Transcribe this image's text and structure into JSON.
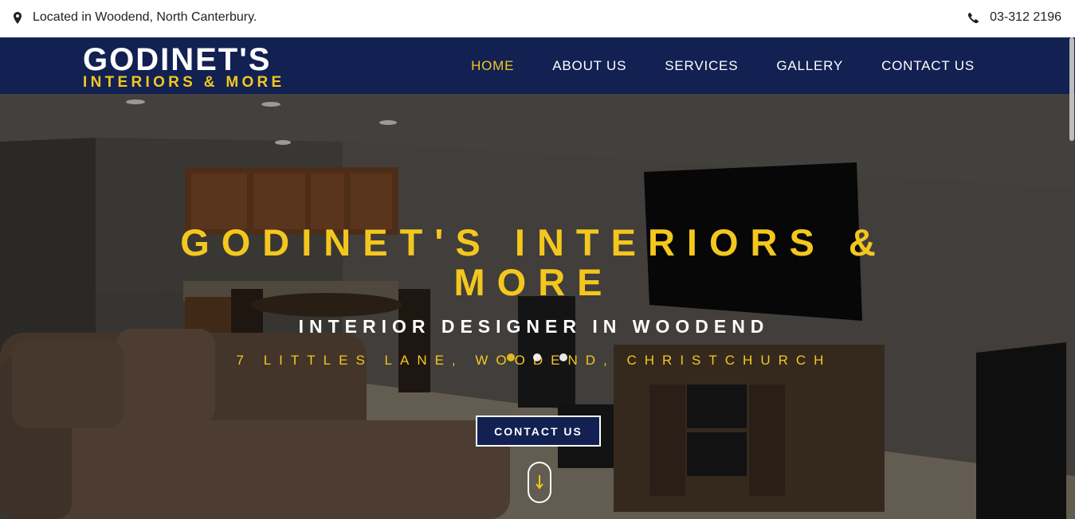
{
  "topbar": {
    "location": "Located in Woodend, North Canterbury.",
    "location_icon": "map-marker-icon",
    "phone": "03-312 2196",
    "phone_icon": "phone-icon"
  },
  "logo": {
    "line1": "GODINET'S",
    "line2": "INTERIORS & MORE"
  },
  "nav": {
    "items": [
      {
        "label": "HOME",
        "active": true
      },
      {
        "label": "ABOUT US",
        "active": false
      },
      {
        "label": "SERVICES",
        "active": false
      },
      {
        "label": "GALLERY",
        "active": false
      },
      {
        "label": "CONTACT US",
        "active": false
      }
    ]
  },
  "hero": {
    "title": "GODINET'S INTERIORS & MORE",
    "subtitle": "INTERIOR DESIGNER IN WOODEND",
    "address": "7 LITTLES LANE, WOODEND, CHRISTCHURCH",
    "cta_label": "CONTACT US",
    "slides": 3,
    "active_slide": 1,
    "scroll_icon": "arrow-down-icon"
  },
  "colors": {
    "navy": "#122152",
    "gold": "#f4c71e",
    "white": "#ffffff"
  }
}
